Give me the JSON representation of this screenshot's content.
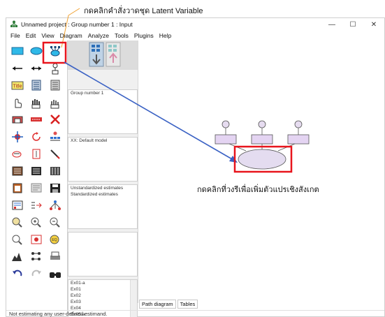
{
  "annotations": {
    "top_callout": "กดคลิกคำสั่งวาดชุด Latent Variable",
    "bottom_callout": "กดคลิกที่วงรีเพื่อเพิ่มตัวแปรเชิงสังเกต"
  },
  "window": {
    "title": "Unnamed project : Group number 1 : Input",
    "controls": {
      "minimize": "—",
      "maximize": "☐",
      "close": "✕"
    }
  },
  "menu": [
    "File",
    "Edit",
    "View",
    "Diagram",
    "Analyze",
    "Tools",
    "Plugins",
    "Help"
  ],
  "toolbox": {
    "icons": [
      "rectangle-icon",
      "ellipse-icon",
      "latent-indicator-icon",
      "single-arrow-icon",
      "double-arrow-icon",
      "unique-variable-icon",
      "title-icon",
      "list-variables-icon",
      "list-data-icon",
      "select-one-icon",
      "select-all-icon",
      "deselect-all-icon",
      "duplicate-icon",
      "move-icon",
      "erase-icon",
      "change-shape-icon",
      "rotate-icon",
      "reflect-icon",
      "move-parameter-icon",
      "scroll-icon",
      "touch-up-icon",
      "data-files-icon",
      "analysis-properties-icon",
      "calculate-estimates-icon",
      "copy-clipboard-icon",
      "view-text-icon",
      "save-icon",
      "object-properties-icon",
      "drag-properties-icon",
      "preserve-symmetry-icon",
      "zoom-area-icon",
      "zoom-in-icon",
      "zoom-out-icon",
      "show-page-icon",
      "resize-fit-icon",
      "magnify-icon",
      "bayesian-icon",
      "multiple-group-icon",
      "print-icon",
      "undo-icon",
      "redo-icon",
      "specification-search-icon"
    ]
  },
  "panels": {
    "groups": [
      "Group number 1"
    ],
    "models": [
      "XX: Default model"
    ],
    "estimates": [
      "Unstandardized estimates",
      "Standardized estimates"
    ],
    "variables": [
      "Ex01-a",
      "Ex01",
      "Ex02",
      "Ex03",
      "Ex04",
      "Ex05-a"
    ]
  },
  "tabs": [
    "Path diagram",
    "Tables"
  ],
  "status": "Not estimating any user-defined estimand.",
  "colors": {
    "highlight": "#e8141c",
    "arrow": "#3b62c4",
    "callout_line": "#f0a030",
    "latent_fill": "#e4dcf0",
    "observed_fill": "#e4d4f2"
  }
}
